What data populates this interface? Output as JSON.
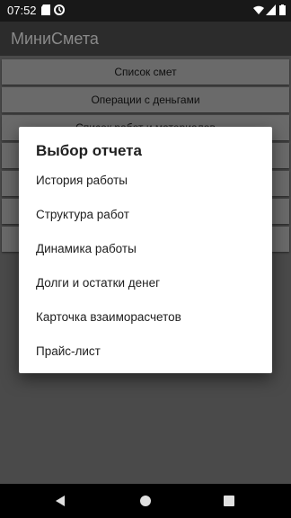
{
  "status_bar": {
    "time": "07:52",
    "icons": [
      "sd-card-icon",
      "sync-icon",
      "wifi-icon",
      "signal-icon",
      "battery-icon"
    ]
  },
  "app_bar": {
    "title": "МиниСмета"
  },
  "menu": {
    "buttons": [
      "Список смет",
      "Операции с деньгами",
      "Список работ и материалов"
    ]
  },
  "dialog": {
    "title": "Выбор отчета",
    "items": [
      "История работы",
      "Структура работ",
      "Динамика работы",
      "Долги и остатки денег",
      "Карточка взаиморасчетов",
      "Прайс-лист"
    ]
  },
  "nav_bar": {
    "buttons": [
      "back-icon",
      "home-icon",
      "recents-icon"
    ]
  },
  "colors": {
    "accent": "#ffffff",
    "dialog_bg": "#ffffff",
    "screen_bg": "#4a4a4a"
  }
}
